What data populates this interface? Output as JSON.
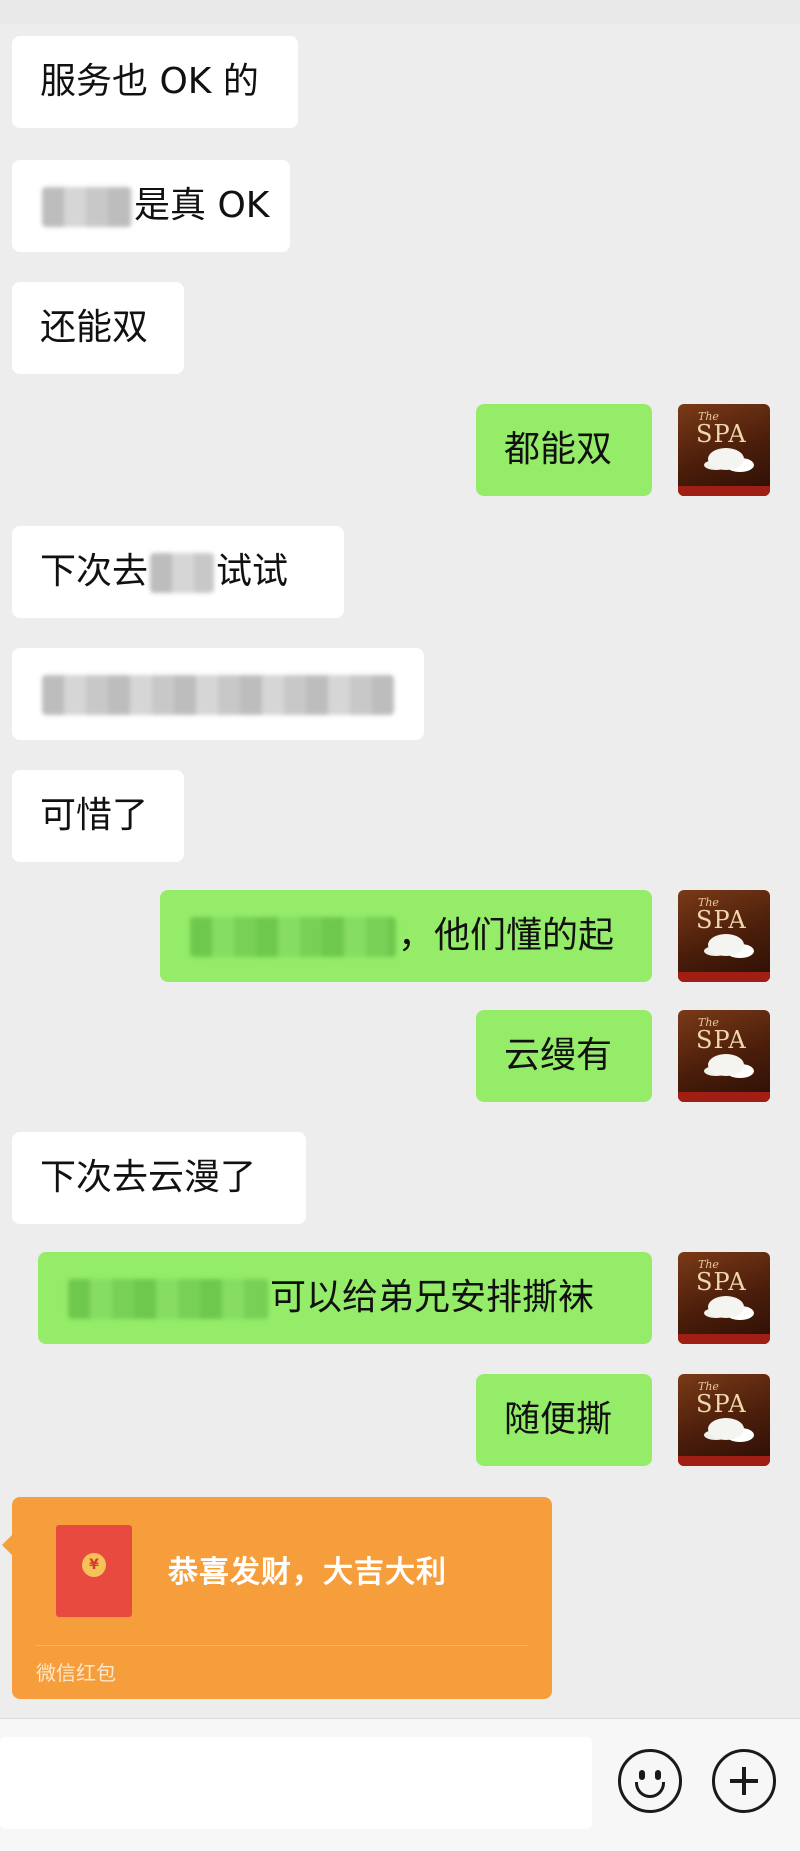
{
  "colors": {
    "background": "#ededed",
    "incoming_bubble": "#ffffff",
    "outgoing_bubble": "#95ec69",
    "red_packet": "#f79e3c"
  },
  "avatar": {
    "line1": "The",
    "line2": "SPA"
  },
  "messages": [
    {
      "side": "incoming",
      "text": "服务也 OK 的"
    },
    {
      "side": "incoming",
      "text_after": "是真 OK",
      "redacted": true
    },
    {
      "side": "incoming",
      "text": "还能双"
    },
    {
      "side": "outgoing",
      "text": "都能双"
    },
    {
      "side": "incoming",
      "text_before": "下次去",
      "text_after": "试试",
      "redacted": true
    },
    {
      "side": "incoming",
      "redacted": true
    },
    {
      "side": "incoming",
      "text": "可惜了"
    },
    {
      "side": "outgoing",
      "text_after": "，他们懂的起",
      "redacted": true
    },
    {
      "side": "outgoing",
      "text": "云缦有"
    },
    {
      "side": "incoming",
      "text": "下次去云漫了"
    },
    {
      "side": "outgoing",
      "text_after": "可以给弟兄安排撕袜",
      "redacted": true
    },
    {
      "side": "outgoing",
      "text": "随便撕"
    }
  ],
  "red_packet": {
    "title": "恭喜发财，大吉大利",
    "footer": "微信红包",
    "coin_symbol": "¥"
  },
  "input_bar": {
    "icons": [
      "emoji-icon",
      "plus-icon"
    ]
  }
}
